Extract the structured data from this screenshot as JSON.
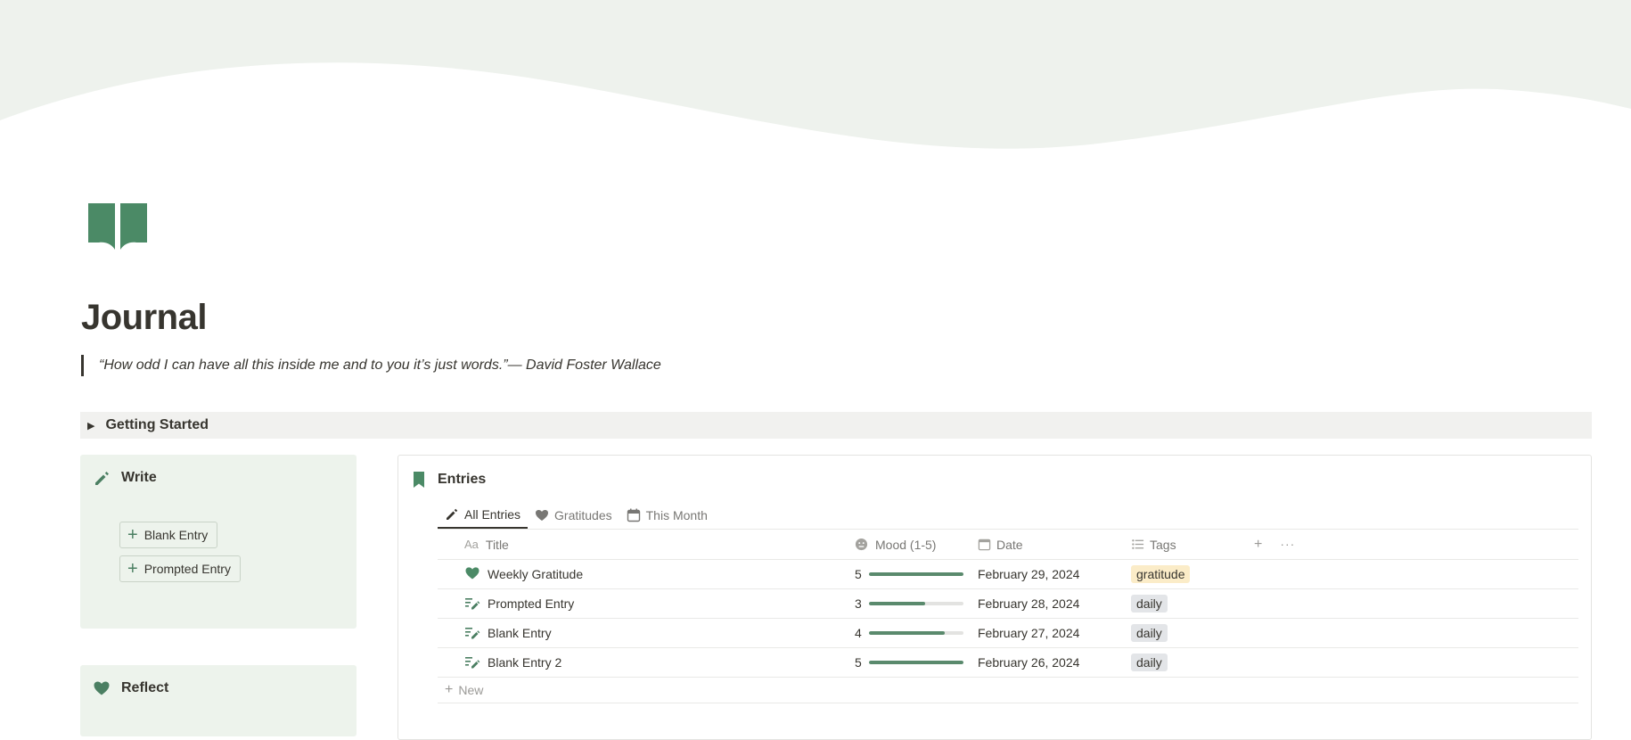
{
  "page": {
    "title": "Journal",
    "quote": "“How odd I can have all this inside me and to you it’s just words.”— David Foster Wallace",
    "icon": "book-open-icon"
  },
  "toggle": {
    "label": "Getting Started"
  },
  "write_card": {
    "heading": "Write",
    "buttons": [
      {
        "label": "Blank Entry"
      },
      {
        "label": "Prompted Entry"
      }
    ]
  },
  "reflect_card": {
    "heading": "Reflect"
  },
  "database": {
    "title": "Entries",
    "tabs": [
      {
        "label": "All Entries",
        "icon": "pencil-icon",
        "active": true
      },
      {
        "label": "Gratitudes",
        "icon": "heart-icon",
        "active": false
      },
      {
        "label": "This Month",
        "icon": "calendar-icon",
        "active": false
      }
    ],
    "columns": {
      "title": "Title",
      "title_prefix": "Aa",
      "mood": "Mood (1-5)",
      "date": "Date",
      "tags": "Tags"
    },
    "rows": [
      {
        "icon": "heart-icon",
        "title": "Weekly Gratitude",
        "mood": "5",
        "mood_fraction": 1.0,
        "date": "February 29, 2024",
        "tag": "gratitude",
        "tag_bg": "#fbecc8"
      },
      {
        "icon": "text-pen-icon",
        "title": "Prompted Entry",
        "mood": "3",
        "mood_fraction": 0.6,
        "date": "February 28, 2024",
        "tag": "daily",
        "tag_bg": "#e3e5e8"
      },
      {
        "icon": "text-pen-icon",
        "title": "Blank Entry",
        "mood": "4",
        "mood_fraction": 0.8,
        "date": "February 27, 2024",
        "tag": "daily",
        "tag_bg": "#e3e5e8"
      },
      {
        "icon": "text-pen-icon",
        "title": "Blank Entry 2",
        "mood": "5",
        "mood_fraction": 1.0,
        "date": "February 26, 2024",
        "tag": "daily",
        "tag_bg": "#e3e5e8"
      }
    ],
    "new_label": "New"
  },
  "colors": {
    "accent": "#4b7f62",
    "card_bg": "#edf3ec",
    "cover_bg": "#eef2ed"
  }
}
